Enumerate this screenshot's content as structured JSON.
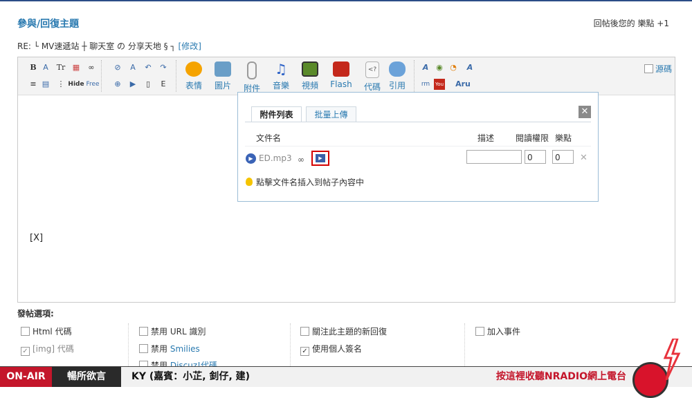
{
  "header": {
    "title": "參與/回復主題",
    "reward": "回帖後您的 樂點 +1"
  },
  "subject": {
    "prefix": "RE: └ MV速遞站 ┼ 聊天室 の 分享天地 § ┐",
    "edit_link": "[修改]"
  },
  "toolbar": {
    "small_icons_row1": [
      "B",
      "A",
      "Tr",
      "▦",
      "∞"
    ],
    "small_icons_row2": [
      "≡",
      "▤",
      "⋮≡",
      "Hide",
      "Free"
    ],
    "buttons": [
      {
        "label": "表情",
        "icon": "smiley-icon",
        "color": "#f5a300"
      },
      {
        "label": "圖片",
        "icon": "image-icon",
        "color": "#6a9ec7"
      },
      {
        "label": "附件",
        "icon": "paperclip-icon",
        "color": "#9a9a9a"
      },
      {
        "label": "音樂",
        "icon": "music-note-icon",
        "color": "#2d62c7"
      },
      {
        "label": "視頻",
        "icon": "video-icon",
        "color": "#5a8a2a"
      },
      {
        "label": "Flash",
        "icon": "flash-icon",
        "color": "#c4281b"
      },
      {
        "label": "代碼",
        "icon": "code-icon",
        "color": "#b0b0b0"
      },
      {
        "label": "引用",
        "icon": "quote-icon",
        "color": "#6ba2d9"
      }
    ],
    "source_label": "源碼"
  },
  "editor": {
    "content": "[X]"
  },
  "attach_popup": {
    "tab_list": "附件列表",
    "tab_batch": "批量上傳",
    "col_filename": "文件名",
    "col_desc": "描述",
    "col_perm": "閱讀權限",
    "col_points": "樂點",
    "file": {
      "name": "ED.mp3",
      "perm_value": "0",
      "points_value": "0"
    },
    "tip": "點擊文件名插入到帖子內容中"
  },
  "options": {
    "title": "發帖選項:",
    "col1": [
      {
        "label": "Html 代碼",
        "checked": false
      },
      {
        "label": "[img] 代碼",
        "checked": true
      }
    ],
    "col2": [
      {
        "prefix": "禁用",
        "label": "URL 識別",
        "checked": false
      },
      {
        "prefix": "禁用",
        "label": "Smilies",
        "checked": false
      },
      {
        "prefix": "禁用",
        "label": "Discuz!代碼",
        "checked": false
      }
    ],
    "col3": [
      {
        "label": "關注此主題的新回復",
        "checked": false
      },
      {
        "label": "使用個人簽名",
        "checked": true
      }
    ],
    "col4": [
      {
        "label": "加入事件",
        "checked": false
      }
    ]
  },
  "radio_bar": {
    "on_air": "ON-AIR",
    "category": "暢所欲言",
    "song": "KY (嘉賓：小芷, 釗仔, 建)",
    "promo": "按這裡收聽NRADIO網上電台"
  }
}
